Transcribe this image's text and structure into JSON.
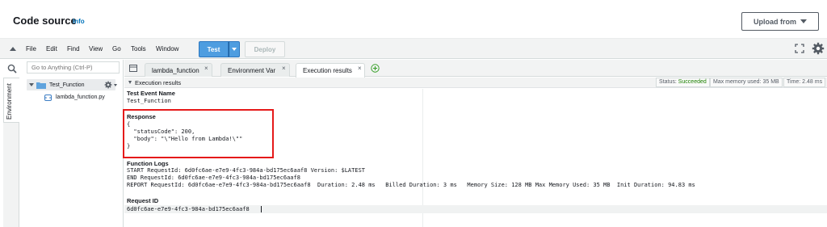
{
  "header": {
    "title": "Code source",
    "info_label": "Info",
    "upload_label": "Upload from"
  },
  "menu": {
    "items": [
      "File",
      "Edit",
      "Find",
      "View",
      "Go",
      "Tools",
      "Window"
    ],
    "test_label": "Test",
    "deploy_label": "Deploy"
  },
  "sidebar": {
    "search_placeholder": "Go to Anything (Ctrl-P)",
    "environment_label": "Environment",
    "folder_name": "Test_Function",
    "file_name": "lambda_function.py"
  },
  "tabs": [
    {
      "label": "lambda_function",
      "active": false
    },
    {
      "label": "Environment Var",
      "active": false
    },
    {
      "label": "Execution results",
      "active": true
    }
  ],
  "results": {
    "section_label": "Execution results",
    "status_label": "Status:",
    "status_value": "Succeeded",
    "max_memory": "Max memory used: 35 MB",
    "time": "Time: 2.48 ms",
    "test_event_name_label": "Test Event Name",
    "test_event_name_value": "Test_Function",
    "response_label": "Response",
    "response_lines": [
      "{",
      "  \"statusCode\": 200,",
      "  \"body\": \"\\\"Hello from Lambda!\\\"\"",
      "}"
    ],
    "function_logs_label": "Function Logs",
    "log_lines": [
      "START RequestId: 6d0fc6ae-e7e9-4fc3-984a-bd175ec6aaf8 Version: $LATEST",
      "END RequestId: 6d0fc6ae-e7e9-4fc3-984a-bd175ec6aaf8",
      "REPORT RequestId: 6d0fc6ae-e7e9-4fc3-984a-bd175ec6aaf8  Duration: 2.48 ms   Billed Duration: 3 ms   Memory Size: 128 MB Max Memory Used: 35 MB  Init Duration: 94.83 ms"
    ],
    "request_id_label": "Request ID",
    "request_id_value": "6d0fc6ae-e7e9-4fc3-984a-bd175ec6aaf8"
  },
  "colors": {
    "accent": "#4e9de0",
    "success": "#1d8102",
    "highlight": "#e51a1a",
    "link": "#0073bb"
  },
  "icons": [
    "search-icon",
    "folder-icon",
    "gear-icon",
    "file-icon",
    "expand-icon",
    "add-tab-icon",
    "tab-list-icon"
  ]
}
